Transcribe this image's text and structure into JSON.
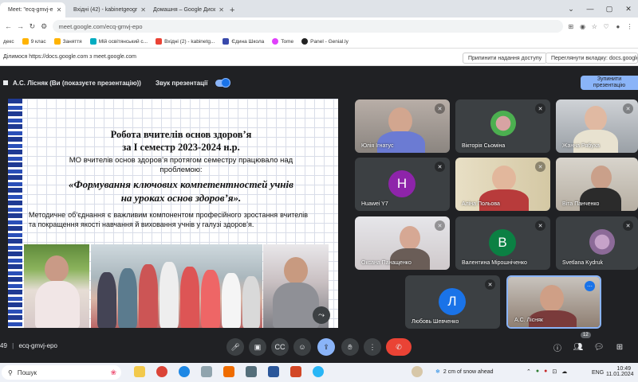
{
  "browser": {
    "tabs": [
      {
        "label": "Meet: \"ecq-gmvj-e",
        "color": "#00897b"
      },
      {
        "label": "Вхідні (42) - kabinetgeogr",
        "color": "#ea4335"
      },
      {
        "label": "Домашня – Google Диск",
        "color": "#34a853"
      }
    ],
    "new_tab": "+",
    "url": "meet.google.com/ecq-gmvj-epo",
    "bookmarks": [
      "декс",
      "9 клас",
      "Заняття",
      "Мій освітянський с...",
      "Вхідні (2) - kabinetg...",
      "Єдина Школа",
      "Tome",
      "Panel - Genial.ly"
    ],
    "share_text": "Ділимося https://docs.google.com з meet.google.com",
    "stop_sharing": "Припинити надання доступу",
    "view_tab": "Переглянути вкладку: docs.google.com"
  },
  "meet": {
    "presenter": "А.С. Лісняк (Ви (показуєте презентацію))",
    "sound_label": "Звук презентації",
    "stop_button": "Зупинити презентацію",
    "meeting_code": "ecq-gmvj-epo",
    "time_prefix": "49",
    "participant_count": "12",
    "colors": {
      "accent": "#8ab4f8",
      "end_call": "#ea4335",
      "bg": "#202124",
      "tile": "#3c4043"
    }
  },
  "slide": {
    "title1": "Робота вчителів основ здоров’я",
    "title2": "за І семестр 2023-2024 н.р.",
    "intro": "МО вчителів основ здоров’я протягом семестру працювало над проблемою:",
    "theme1": "«Формування ключових компетентностей учнів",
    "theme2": "на уроках основ здоров’я».",
    "body": "Методичне об’єднання є важливим компонентом професійного зростання вчителів та покращення якості навчання й виховання учнів у галузі здоров’я."
  },
  "participants": [
    {
      "name": "Юлія Ігнатус",
      "type": "video"
    },
    {
      "name": "Вікторія Сьоміна",
      "type": "photo"
    },
    {
      "name": "Жанна Рябуха",
      "type": "video"
    },
    {
      "name": "Huawei Y7",
      "type": "avatar",
      "letter": "H",
      "color": "#8e24aa"
    },
    {
      "name": "Аліна Польова",
      "type": "video"
    },
    {
      "name": "Віта Панченко",
      "type": "video"
    },
    {
      "name": "Оксана Панащенко",
      "type": "video"
    },
    {
      "name": "Валентина Мірошніченко",
      "type": "avatar",
      "letter": "В",
      "color": "#0b8043"
    },
    {
      "name": "Svetlana Kydruk",
      "type": "photo"
    },
    {
      "name": "Любовь Шевченко",
      "type": "avatar",
      "letter": "Л",
      "color": "#1a73e8"
    },
    {
      "name": "А.С. Лісняк",
      "type": "video"
    }
  ],
  "taskbar": {
    "search_label": "Пошук",
    "weather": "2 cm of snow ahead",
    "lang": "ENG",
    "time": "10:49",
    "date": "11.01.2024"
  }
}
